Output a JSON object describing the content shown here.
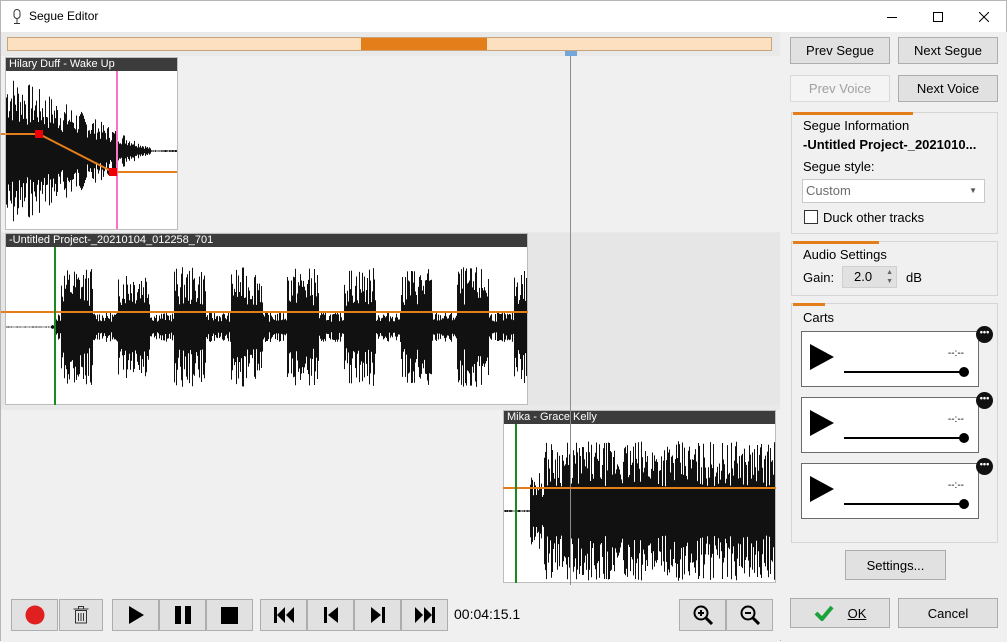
{
  "window": {
    "title": "Segue Editor",
    "icons": {
      "app": "microphone-icon",
      "minimize": "minimize-icon",
      "maximize": "maximize-icon",
      "close": "close-icon"
    }
  },
  "tracks": [
    {
      "name": "Hilary Duff - Wake Up"
    },
    {
      "name": "-Untitled Project-_20210104_012258_701"
    },
    {
      "name": "Mika - Grace Kelly"
    }
  ],
  "colors": {
    "accent": "#e47e1b",
    "header": "#3c3c3c",
    "marker_green": "#1a8a1a",
    "marker_pink": "#ff6ec7",
    "record_red": "#e02020",
    "ok_green": "#1aa33a"
  },
  "transport": {
    "time": "00:04:15.1",
    "icons": [
      "record-icon",
      "trash-icon",
      "play-icon",
      "pause-icon",
      "stop-icon",
      "skip-to-start-icon",
      "step-back-icon",
      "step-forward-icon",
      "skip-to-end-icon",
      "zoom-in-icon",
      "zoom-out-icon"
    ]
  },
  "side": {
    "prev_segue": "Prev Segue",
    "next_segue": "Next Segue",
    "prev_voice": "Prev Voice",
    "next_voice": "Next Voice",
    "segue_info": {
      "label": "Segue Information",
      "name": "-Untitled Project-_2021010...",
      "style_label": "Segue style:",
      "style_value": "Custom",
      "duck_label": "Duck other tracks",
      "duck_checked": false
    },
    "audio": {
      "label": "Audio Settings",
      "gain_label": "Gain:",
      "gain_value": "2.0",
      "gain_unit": "dB"
    },
    "carts": {
      "label": "Carts",
      "items": [
        {
          "time": "--:--"
        },
        {
          "time": "--:--"
        },
        {
          "time": "--:--"
        }
      ]
    },
    "settings": "Settings...",
    "ok": "OK",
    "cancel": "Cancel"
  }
}
